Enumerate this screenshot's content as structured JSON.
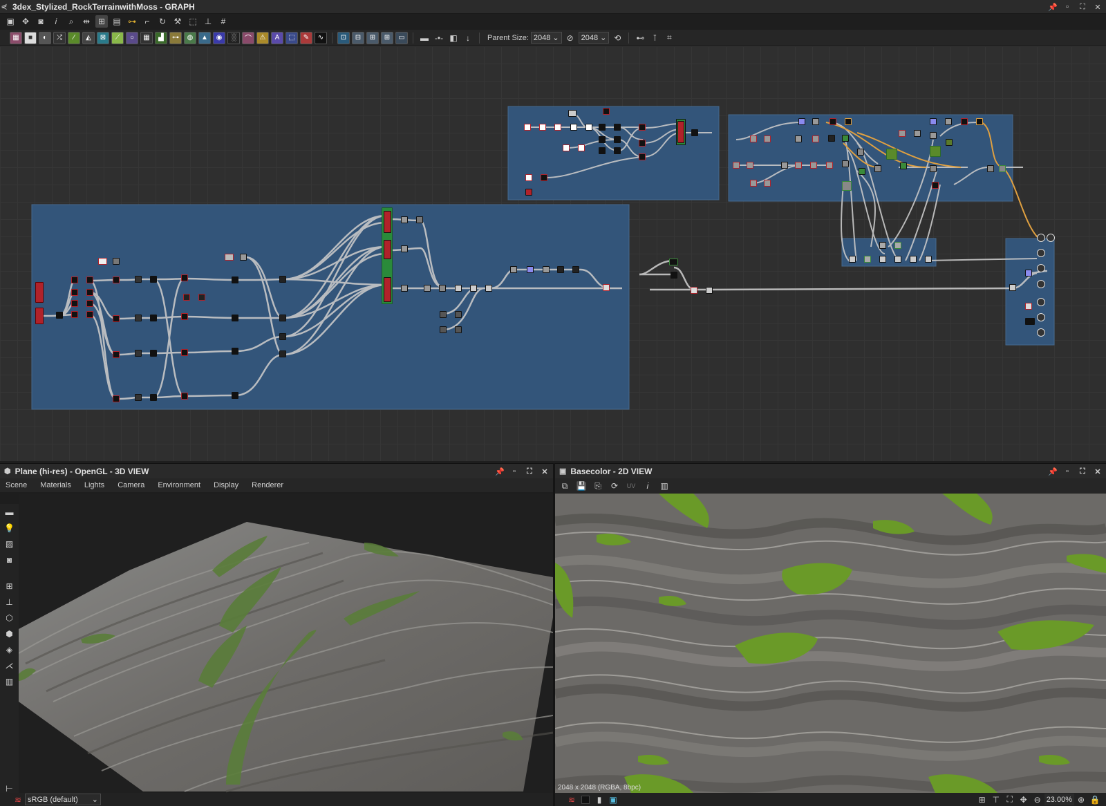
{
  "window": {
    "title": "3dex_Stylized_RockTerrainwithMoss - GRAPH"
  },
  "toolbar": {
    "parent_size_label": "Parent Size:",
    "parent_size_value": "2048",
    "size_value": "2048"
  },
  "view3d": {
    "title": "Plane (hi-res) - OpenGL - 3D VIEW",
    "menu": [
      "Scene",
      "Materials",
      "Lights",
      "Camera",
      "Environment",
      "Display",
      "Renderer"
    ],
    "colorspace": "sRGB (default)"
  },
  "view2d": {
    "title": "Basecolor - 2D VIEW",
    "uv_label": "UV",
    "info": "2048 x 2048 (RGBA, 8bpc)",
    "zoom": "23.00%"
  },
  "colors": {
    "frame": "#33557a",
    "grid": "#2f2f2f",
    "moss": "#6b9a2a",
    "rock": "#777572"
  }
}
